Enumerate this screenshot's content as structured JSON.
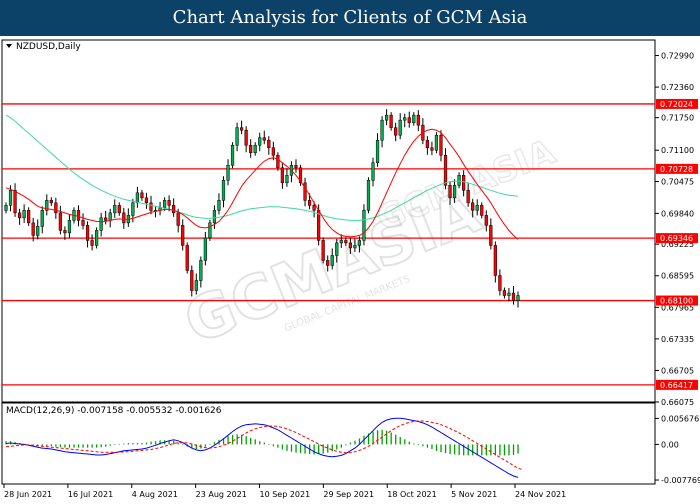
{
  "banner": {
    "title": "Chart Analysis for Clients of GCM Asia"
  },
  "colors": {
    "banner": "#0d4268",
    "level": "#ff0000",
    "ma_fast": "#ff0000",
    "ma_slow": "#3fd9a0",
    "candle_up": "#00b050",
    "candle_down": "#ff0000",
    "macd_hist": "#00a000",
    "macd_line": "#0000ff",
    "macd_signal": "#ff0000"
  },
  "chart_data": [
    {
      "type": "candlestick",
      "symbol_label": "NZDUSD,Daily",
      "ylim": [
        0.66075,
        0.733
      ],
      "y_ticks": [
        "0.72990",
        "0.72360",
        "0.71750",
        "0.71100",
        "0.70475",
        "0.69840",
        "0.69225",
        "0.68595",
        "0.67965",
        "0.67335",
        "0.66705",
        "0.66075"
      ],
      "x_ticks": [
        "28 Jun 2021",
        "16 Jul 2021",
        "4 Aug 2021",
        "23 Aug 2021",
        "10 Sep 2021",
        "29 Sep 2021",
        "18 Oct 2021",
        "5 Nov 2021",
        "24 Nov 2021"
      ],
      "levels": [
        {
          "label": "0.72024",
          "value": 0.72024
        },
        {
          "label": "0.70728",
          "value": 0.70728
        },
        {
          "label": "0.69346",
          "value": 0.69346
        },
        {
          "label": "0.68100",
          "value": 0.681
        },
        {
          "label": "0.66417",
          "value": 0.66417
        }
      ],
      "close": [
        0.7,
        0.703,
        0.6985,
        0.6975,
        0.699,
        0.6965,
        0.694,
        0.6958,
        0.699,
        0.701,
        0.7005,
        0.6985,
        0.695,
        0.6945,
        0.697,
        0.699,
        0.697,
        0.696,
        0.693,
        0.692,
        0.695,
        0.6975,
        0.697,
        0.6985,
        0.7,
        0.6985,
        0.6965,
        0.698,
        0.7005,
        0.7025,
        0.7015,
        0.7005,
        0.699,
        0.699,
        0.6995,
        0.701,
        0.7,
        0.6985,
        0.696,
        0.692,
        0.687,
        0.683,
        0.685,
        0.689,
        0.6935,
        0.6965,
        0.699,
        0.701,
        0.705,
        0.708,
        0.712,
        0.7155,
        0.715,
        0.712,
        0.7105,
        0.712,
        0.7135,
        0.713,
        0.7115,
        0.71,
        0.7075,
        0.7045,
        0.706,
        0.708,
        0.7075,
        0.7045,
        0.701,
        0.7,
        0.699,
        0.693,
        0.689,
        0.688,
        0.69,
        0.6925,
        0.693,
        0.6925,
        0.6915,
        0.692,
        0.693,
        0.699,
        0.705,
        0.7085,
        0.713,
        0.717,
        0.718,
        0.7155,
        0.714,
        0.717,
        0.7175,
        0.7165,
        0.718,
        0.716,
        0.713,
        0.7115,
        0.711,
        0.714,
        0.71,
        0.704,
        0.7015,
        0.704,
        0.706,
        0.703,
        0.7005,
        0.699,
        0.7,
        0.698,
        0.696,
        0.692,
        0.686,
        0.683,
        0.682,
        0.6825,
        0.681,
        0.682
      ],
      "ma_fast": [
        0.7035,
        0.7032,
        0.7028,
        0.7023,
        0.7018,
        0.7012,
        0.7005,
        0.6998,
        0.6995,
        0.6993,
        0.6992,
        0.699,
        0.6988,
        0.6985,
        0.6982,
        0.698,
        0.6978,
        0.6975,
        0.6972,
        0.697,
        0.6968,
        0.6967,
        0.6968,
        0.697,
        0.6972,
        0.6973,
        0.6972,
        0.6972,
        0.6974,
        0.6977,
        0.698,
        0.6983,
        0.6986,
        0.6988,
        0.699,
        0.6992,
        0.6992,
        0.699,
        0.6987,
        0.6982,
        0.6975,
        0.6967,
        0.696,
        0.6956,
        0.6955,
        0.6957,
        0.6962,
        0.6968,
        0.6978,
        0.699,
        0.7005,
        0.7022,
        0.7038,
        0.705,
        0.706,
        0.707,
        0.708,
        0.7088,
        0.7093,
        0.7095,
        0.7092,
        0.7085,
        0.7078,
        0.707,
        0.706,
        0.7048,
        0.7035,
        0.702,
        0.7005,
        0.699,
        0.6975,
        0.6962,
        0.6952,
        0.6945,
        0.694,
        0.6938,
        0.6937,
        0.6938,
        0.694,
        0.6945,
        0.6955,
        0.6968,
        0.6985,
        0.7005,
        0.7025,
        0.7045,
        0.7065,
        0.7083,
        0.71,
        0.7115,
        0.7128,
        0.7138,
        0.7145,
        0.715,
        0.7152,
        0.715,
        0.7145,
        0.7135,
        0.7122,
        0.711,
        0.7097,
        0.7082,
        0.7068,
        0.7055,
        0.7042,
        0.703,
        0.7018,
        0.7005,
        0.699,
        0.6975,
        0.6962,
        0.695,
        0.694,
        0.6932
      ],
      "ma_slow": [
        0.718,
        0.7175,
        0.7168,
        0.716,
        0.7152,
        0.7144,
        0.7136,
        0.7128,
        0.712,
        0.7112,
        0.7104,
        0.7096,
        0.7088,
        0.708,
        0.7072,
        0.7065,
        0.7058,
        0.7052,
        0.7046,
        0.704,
        0.7035,
        0.703,
        0.7026,
        0.7022,
        0.7018,
        0.7015,
        0.7012,
        0.701,
        0.7008,
        0.7006,
        0.7004,
        0.7002,
        0.7,
        0.6998,
        0.6996,
        0.6994,
        0.6992,
        0.699,
        0.6987,
        0.6984,
        0.6981,
        0.6978,
        0.6976,
        0.6975,
        0.6974,
        0.6974,
        0.6975,
        0.6976,
        0.6978,
        0.698,
        0.6983,
        0.6986,
        0.6989,
        0.6991,
        0.6993,
        0.6994,
        0.6995,
        0.6996,
        0.6997,
        0.6997,
        0.6997,
        0.6996,
        0.6995,
        0.6994,
        0.6993,
        0.6992,
        0.699,
        0.6988,
        0.6986,
        0.6983,
        0.698,
        0.6977,
        0.6975,
        0.6973,
        0.6972,
        0.6971,
        0.697,
        0.697,
        0.697,
        0.6971,
        0.6973,
        0.6975,
        0.6978,
        0.6982,
        0.6986,
        0.699,
        0.6995,
        0.7,
        0.7005,
        0.701,
        0.7015,
        0.702,
        0.7025,
        0.703,
        0.7034,
        0.7038,
        0.7042,
        0.7045,
        0.7047,
        0.7048,
        0.7048,
        0.7047,
        0.7045,
        0.7042,
        0.7039,
        0.7036,
        0.7033,
        0.703,
        0.7027,
        0.7024,
        0.7022,
        0.702,
        0.7019,
        0.7018
      ]
    },
    {
      "type": "bar",
      "label": "MACD(12,26,9) -0.007158 -0.005532 -0.001626",
      "ylim": [
        -0.0082,
        0.0062
      ],
      "y_ticks": [
        {
          "label": "0.005676",
          "value": 0.005676
        },
        {
          "label": "0.00",
          "value": 0.0
        },
        {
          "label": "-0.007769",
          "value": -0.007769
        }
      ],
      "macd": [
        0.0002,
        0.0003,
        0.0002,
        0.0001,
        0.0,
        -0.0002,
        -0.0004,
        -0.0006,
        -0.0008,
        -0.0009,
        -0.001,
        -0.0012,
        -0.0014,
        -0.0016,
        -0.0017,
        -0.0018,
        -0.0019,
        -0.002,
        -0.0021,
        -0.0022,
        -0.0023,
        -0.0023,
        -0.0022,
        -0.002,
        -0.0018,
        -0.0016,
        -0.0014,
        -0.0013,
        -0.0012,
        -0.0011,
        -0.001,
        -0.0008,
        -0.0005,
        -0.0002,
        0.0002,
        0.0005,
        0.0008,
        0.001,
        0.0008,
        0.0004,
        -0.0002,
        -0.0008,
        -0.0012,
        -0.0014,
        -0.0012,
        -0.0008,
        -0.0002,
        0.0005,
        0.0012,
        0.002,
        0.0028,
        0.0035,
        0.004,
        0.0043,
        0.0044,
        0.0045,
        0.0044,
        0.0043,
        0.004,
        0.0036,
        0.0032,
        0.0026,
        0.002,
        0.0014,
        0.0008,
        0.0002,
        -0.0004,
        -0.001,
        -0.0016,
        -0.002,
        -0.0024,
        -0.0026,
        -0.0027,
        -0.0026,
        -0.0024,
        -0.002,
        -0.0014,
        -0.0008,
        0.0,
        0.001,
        0.002,
        0.003,
        0.004,
        0.0048,
        0.0053,
        0.0056,
        0.0057,
        0.0057,
        0.0056,
        0.0054,
        0.0052,
        0.005,
        0.0047,
        0.0043,
        0.0038,
        0.0032,
        0.0026,
        0.002,
        0.0014,
        0.0008,
        0.0002,
        -0.0004,
        -0.001,
        -0.0016,
        -0.0022,
        -0.0028,
        -0.0034,
        -0.004,
        -0.0046,
        -0.0052,
        -0.0058,
        -0.0064,
        -0.0069,
        -0.0072
      ],
      "signal": [
        -0.0005,
        -0.0004,
        -0.0003,
        -0.0002,
        -0.0001,
        -0.0001,
        -0.0002,
        -0.0003,
        -0.0004,
        -0.0005,
        -0.0006,
        -0.0007,
        -0.0008,
        -0.0009,
        -0.001,
        -0.0011,
        -0.0012,
        -0.0013,
        -0.0014,
        -0.0015,
        -0.0016,
        -0.0017,
        -0.0017,
        -0.0017,
        -0.0017,
        -0.0017,
        -0.0016,
        -0.0016,
        -0.0015,
        -0.0014,
        -0.0013,
        -0.0012,
        -0.0011,
        -0.0009,
        -0.0007,
        -0.0004,
        -0.0001,
        0.0002,
        0.0004,
        0.0004,
        0.0003,
        0.0001,
        -0.0002,
        -0.0005,
        -0.0007,
        -0.0008,
        -0.0007,
        -0.0005,
        -0.0002,
        0.0002,
        0.0007,
        0.0013,
        0.0019,
        0.0025,
        0.003,
        0.0034,
        0.0037,
        0.0039,
        0.004,
        0.004,
        0.0039,
        0.0037,
        0.0034,
        0.003,
        0.0026,
        0.0021,
        0.0016,
        0.0011,
        0.0006,
        0.0001,
        -0.0004,
        -0.0008,
        -0.0012,
        -0.0015,
        -0.0017,
        -0.0018,
        -0.0018,
        -0.0016,
        -0.0013,
        -0.0009,
        -0.0004,
        0.0002,
        0.0009,
        0.0016,
        0.0023,
        0.003,
        0.0036,
        0.0041,
        0.0045,
        0.0048,
        0.005,
        0.0051,
        0.0051,
        0.005,
        0.0048,
        0.0046,
        0.0043,
        0.0039,
        0.0035,
        0.003,
        0.0025,
        0.002,
        0.0014,
        0.0008,
        0.0002,
        -0.0004,
        -0.001,
        -0.0016,
        -0.0022,
        -0.0028,
        -0.0034,
        -0.004,
        -0.0046,
        -0.0052,
        -0.0055
      ]
    }
  ]
}
